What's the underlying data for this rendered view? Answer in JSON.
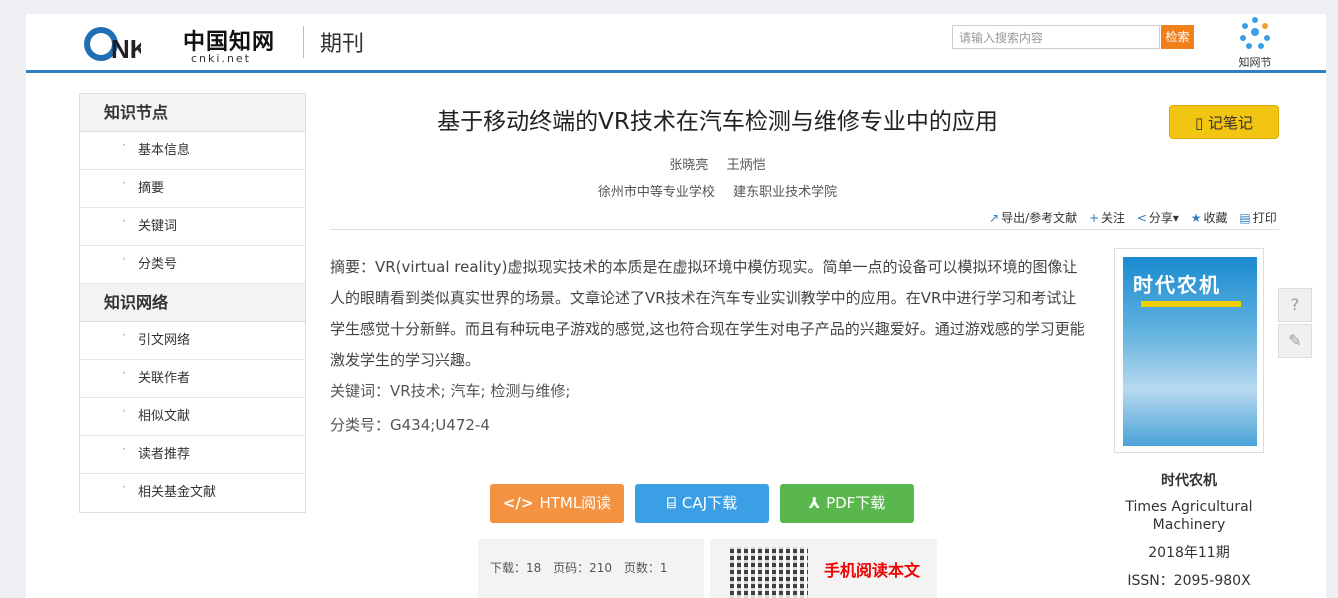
{
  "header": {
    "logo_text": "中国知网",
    "logo_sub": "cnki.net",
    "section": "期刊",
    "search_placeholder": "请输入搜索内容",
    "search_button": "检索",
    "zwj_label": "知网节"
  },
  "sidebar": {
    "groups": [
      {
        "title": "知识节点",
        "items": [
          "基本信息",
          "摘要",
          "关键词",
          "分类号"
        ]
      },
      {
        "title": "知识网络",
        "items": [
          "引文网络",
          "关联作者",
          "相似文献",
          "读者推荐",
          "相关基金文献"
        ]
      }
    ]
  },
  "article": {
    "title": "基于移动终端的VR技术在汽车检测与维修专业中的应用",
    "note_button": "记笔记",
    "authors": [
      "张晓亮",
      "王炳恺"
    ],
    "orgs": [
      "徐州市中等专业学校",
      "建东职业技术学院"
    ],
    "tools": [
      "导出/参考文献",
      "关注",
      "分享",
      "收藏",
      "打印"
    ],
    "abstract": "摘要：VR(virtual reality)虚拟现实技术的本质是在虚拟环境中模仿现实。简单一点的设备可以模拟环境的图像让人的眼睛看到类似真实世界的场景。文章论述了VR技术在汽车专业实训教学中的应用。在VR中进行学习和考试让学生感觉十分新鲜。而且有种玩电子游戏的感觉,这也符合现在学生对电子产品的兴趣爱好。通过游戏感的学习更能激发学生的学习兴趣。",
    "keywords": "关键词：VR技术; 汽车; 检测与维修;",
    "classification": "分类号：G434;U472-4"
  },
  "downloads": {
    "html": "HTML阅读",
    "caj": "CAJ下载",
    "pdf": "PDF下载"
  },
  "stats": {
    "downloads": "下载：18",
    "pages": "页码：210",
    "page_count": "页数：1"
  },
  "mobile": {
    "label": "手机阅读本文"
  },
  "journal": {
    "cover_title": "时代农机",
    "name_cn": "时代农机",
    "name_en": "Times Agricultural Machinery",
    "date": "2018年11期",
    "issn": "ISSN：2095-980X"
  }
}
